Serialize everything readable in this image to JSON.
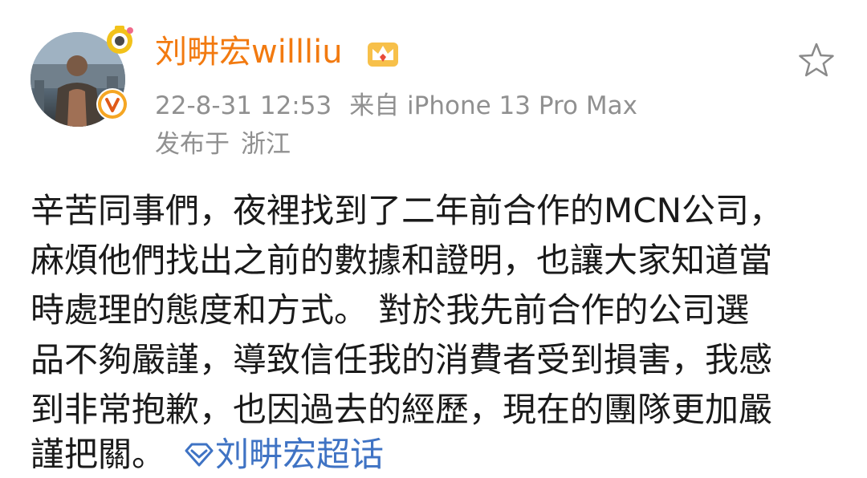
{
  "post": {
    "author": {
      "username": "刘畊宏willliu",
      "avatar_icon": "avatar-photo",
      "fan_badge_icon": "fan-badge-icon",
      "verified_icon": "verified-v-icon",
      "vip_icon": "crown-icon"
    },
    "timestamp": "22-8-31 12:53",
    "source": "来自 iPhone 13 Pro Max",
    "location_prefix": "发布于",
    "location": "浙江",
    "favorite_icon": "star-outline-icon",
    "body_lines": [
      "辛苦同事們，夜裡找到了二年前合作的MCN公司，",
      "麻煩他們找出之前的數據和證明，也讓大家知道當",
      "時處理的態度和方式。 對於我先前合作的公司選",
      "品不夠嚴謹，導致信任我的消費者受到損害，我感",
      "到非常抱歉，也因過去的經歷，現在的團隊更加嚴",
      "謹把關。"
    ],
    "topic_tag": {
      "icon": "diamond-icon",
      "label": "刘畊宏超话"
    }
  },
  "colors": {
    "username": "#f27a10",
    "meta": "#909090",
    "body": "#1a1a1a",
    "link": "#3f73c4",
    "verified": "#f5a623"
  }
}
